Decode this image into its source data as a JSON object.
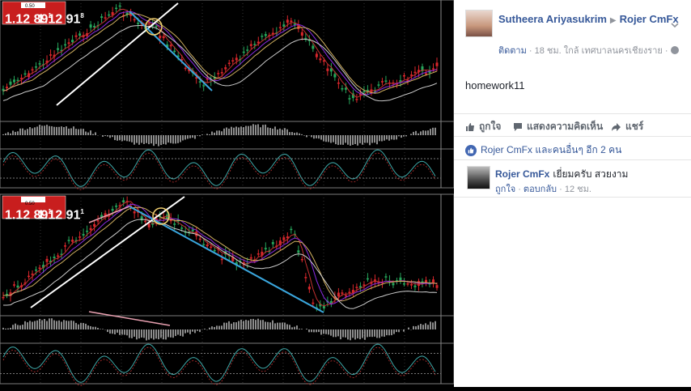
{
  "post": {
    "author": "Sutheera Ariyasukrim",
    "target": "Rojer CmFx",
    "follow_label": "ติดตาม",
    "meta_text": " · 18 ชม. ใกล้ เทศบาลนครเชียงราย ·",
    "body": "homework11"
  },
  "actions": {
    "like": "ถูกใจ",
    "comment": "แสดงความคิดเห็น",
    "share": "แชร์"
  },
  "reactions": {
    "text": "Rojer CmFx และคนอื่นๆ อีก 2 คน"
  },
  "comment": {
    "author": "Rojer CmFx",
    "text": "เยี่ยมครับ สวยงาม",
    "like": "ถูกใจ",
    "reply": "ตอบกลับ",
    "time": "12 ชม."
  },
  "chart_top": {
    "bid": "1.12 89",
    "ask": "1.12 91",
    "bid_sup": "1",
    "ask_sup": "8",
    "lot": "0.50"
  },
  "chart_bottom": {
    "bid": "1.12 89",
    "ask": "1.12 91",
    "bid_sup": "1",
    "ask_sup": "1",
    "lot": "0.50"
  },
  "colors": {
    "bull": "#26a65b",
    "bear": "#d8262b",
    "trend": "#ffffff",
    "channel": "#3aa6dd",
    "circle": "#f2d070",
    "link": "#365899"
  }
}
